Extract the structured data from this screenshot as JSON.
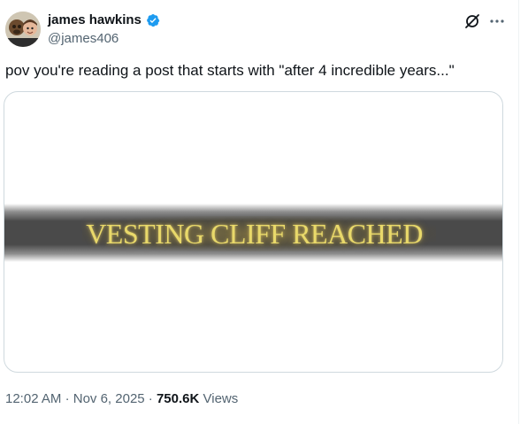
{
  "tweet": {
    "author": {
      "display_name": "james hawkins",
      "handle": "@james406",
      "verified": true
    },
    "text": "pov you're reading a post that starts with \"after 4 incredible years...\"",
    "media": {
      "caption": "VESTING CLIFF REACHED"
    },
    "meta": {
      "time": "12:02 AM",
      "separator": "·",
      "date": "Nov 6, 2025",
      "views_count": "750.6K",
      "views_label": "Views"
    }
  },
  "icons": {
    "verified": "verified-badge-icon",
    "grok": "grok-icon",
    "more": "more-options-icon"
  },
  "colors": {
    "text_primary": "#0f1419",
    "text_secondary": "#536471",
    "verified_blue": "#1d9bf0",
    "border": "#cfd9de",
    "caption_gold": "#e9d96a"
  }
}
